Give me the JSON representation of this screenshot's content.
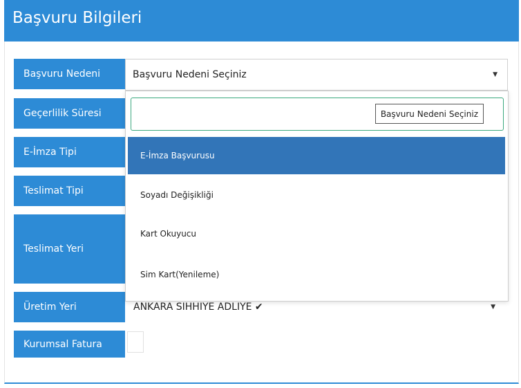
{
  "panel": {
    "title": "Başvuru Bilgileri"
  },
  "fields": {
    "basvuru_nedeni": {
      "label": "Başvuru Nedeni",
      "value": "Başvuru Nedeni Seçiniz"
    },
    "gecerlilik_suresi": {
      "label": "Geçerlilik Süresi"
    },
    "eimza_tipi": {
      "label": "E-İmza Tipi"
    },
    "teslimat_tipi": {
      "label": "Teslimat Tipi"
    },
    "teslimat_yeri": {
      "label": "Teslimat Yeri"
    },
    "uretim_yeri": {
      "label": "Üretim Yeri",
      "value": "ANKARA SIHHIYE ADLIYE ✔"
    },
    "kurumsal_fatura": {
      "label": "Kurumsal Fatura",
      "checked": false
    }
  },
  "dropdown": {
    "search_value": "",
    "tooltip": "Başvuru Nedeni Seçiniz",
    "options": [
      {
        "label": "E-İmza Başvurusu",
        "highlighted": true
      },
      {
        "label": "Soyadı Değişikliği",
        "highlighted": false
      },
      {
        "label": "Kart Okuyucu",
        "highlighted": false
      },
      {
        "label": "Sim Kart(Yenileme)",
        "highlighted": false
      }
    ]
  },
  "colors": {
    "header": "#2d8bd6",
    "highlight": "#3275b8",
    "search_border": "#3aa87e"
  }
}
